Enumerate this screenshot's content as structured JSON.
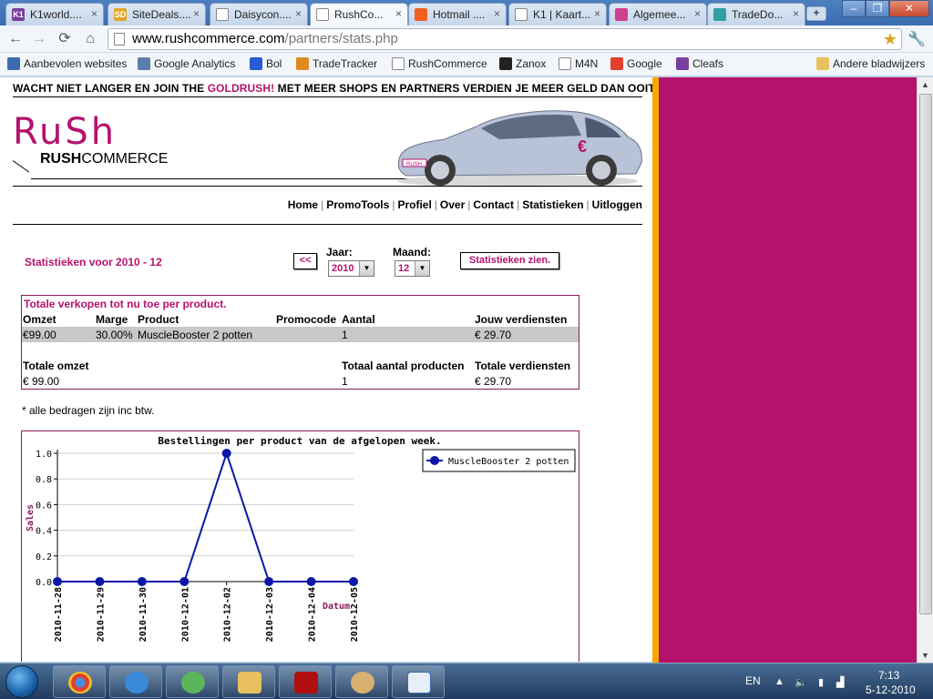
{
  "browser": {
    "tabs": [
      {
        "title": "K1world....",
        "fav_color": "#7a3fa0",
        "fav": "K1"
      },
      {
        "title": "SiteDeals....",
        "fav_color": "#e2a526",
        "fav": "SD"
      },
      {
        "title": "Daisycon....",
        "fav_color": "#ffffff",
        "fav": ""
      },
      {
        "title": "RushCo...",
        "fav_color": "#ffffff",
        "fav": ""
      },
      {
        "title": "Hotmail ....",
        "fav_color": "#f06020",
        "fav": ""
      },
      {
        "title": "K1 | Kaart...",
        "fav_color": "#ffffff",
        "fav": ""
      },
      {
        "title": "Algemee...",
        "fav_color": "#d04090",
        "fav": ""
      },
      {
        "title": "TradeDo...",
        "fav_color": "#30a0a0",
        "fav": ""
      }
    ],
    "url_host": "www.rushcommerce.com",
    "url_path": "/partners/stats.php",
    "bookmarks": [
      {
        "label": "Aanbevolen websites",
        "color": "#3b6cb0"
      },
      {
        "label": "Google Analytics",
        "color": "#5b7fa8"
      },
      {
        "label": "Bol",
        "color": "#2a5bd7"
      },
      {
        "label": "TradeTracker",
        "color": "#e08a20"
      },
      {
        "label": "RushCommerce",
        "color": "#ffffff"
      },
      {
        "label": "Zanox",
        "color": "#222222"
      },
      {
        "label": "M4N",
        "color": "#ffffff"
      },
      {
        "label": "Google",
        "color": "#e04030"
      },
      {
        "label": "Cleafs",
        "color": "#7a3fa0"
      },
      {
        "label": "Andere bladwijzers",
        "color": "#e8c060"
      }
    ]
  },
  "page": {
    "slogan_pre": "WACHT NIET LANGER EN JOIN THE ",
    "slogan_gold": "GOLDRUSH!",
    "slogan_post": " MET MEER SHOPS EN PARTNERS VERDIEN JE MEER GELD DAN OOIT",
    "logo_big": "RuSh",
    "logo_rush": "RUSH",
    "logo_commerce": "COMMERCE",
    "nav": [
      "Home",
      "PromoTools",
      "Profiel",
      "Over",
      "Contact",
      "Statistieken",
      "Uitloggen"
    ],
    "stats_title": "Statistieken voor 2010 - 12",
    "prev_label": "<<",
    "year_label": "Jaar:",
    "year_value": "2010",
    "month_label": "Maand:",
    "month_value": "12",
    "show_label": "Statistieken zien.",
    "totals": {
      "caption": "Totale verkopen tot nu toe per product.",
      "headers": [
        "Omzet",
        "Marge",
        "Product",
        "Promocode",
        "Aantal",
        "Jouw verdiensten"
      ],
      "row": [
        "€99.00",
        "30.00%",
        "MuscleBooster 2 potten",
        "",
        "1",
        "€ 29.70"
      ],
      "sum_headers": {
        "omzet": "Totale omzet",
        "aantal": "Totaal aantal producten",
        "verdiensten": "Totale verdiensten"
      },
      "sum_values": {
        "omzet": "€ 99.00",
        "aantal": "1",
        "verdiensten": "€ 29.70"
      }
    },
    "note": "* alle bedragen zijn inc btw."
  },
  "chart_data": {
    "type": "line",
    "title": "Bestellingen per product van de afgelopen week.",
    "xlabel": "Datum",
    "ylabel": "Sales",
    "x": [
      "2010-11-28",
      "2010-11-29",
      "2010-11-30",
      "2010-12-01",
      "2010-12-02",
      "2010-12-03",
      "2010-12-04",
      "2010-12-05"
    ],
    "ylim": [
      0,
      1.0
    ],
    "yticks": [
      "0.0",
      "0.2",
      "0.4",
      "0.6",
      "0.8",
      "1.0"
    ],
    "series": [
      {
        "name": "MuscleBooster 2 potten",
        "values": [
          0,
          0,
          0,
          0,
          1,
          0,
          0,
          0
        ],
        "color": "#0a17a8"
      }
    ],
    "grid": true,
    "legend": "top-right"
  },
  "taskbar": {
    "lang": "EN",
    "time": "7:13",
    "date": "5-12-2010"
  },
  "colors": {
    "brand": "#b5126d",
    "accent": "#f7a800"
  }
}
